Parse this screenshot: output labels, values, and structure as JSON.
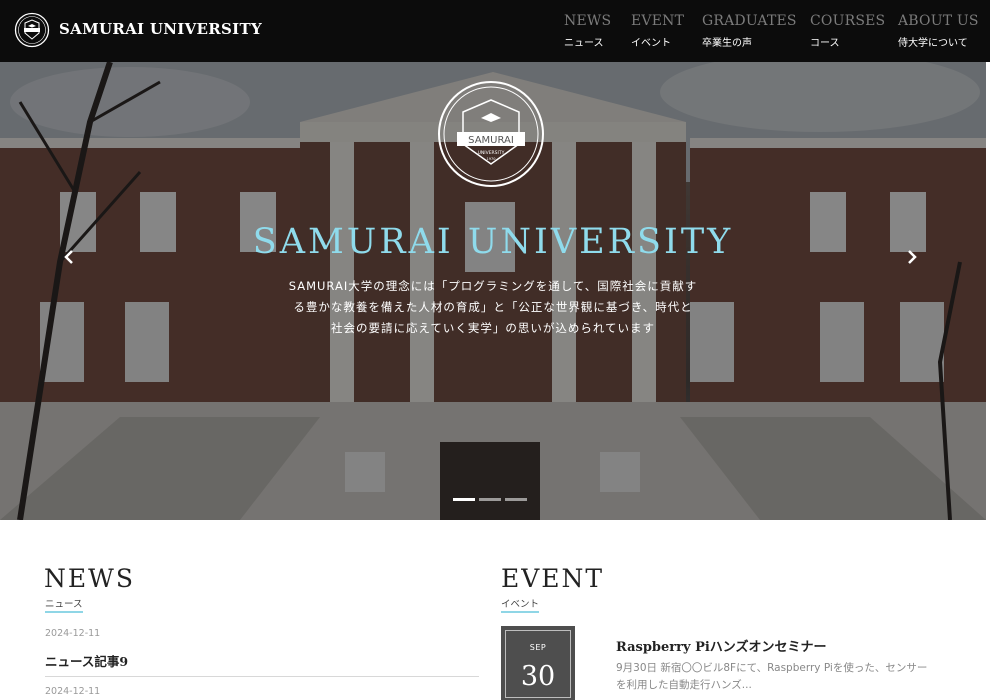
{
  "header": {
    "site_name": "SAMURAI UNIVERSITY",
    "nav": [
      {
        "en": "NEWS",
        "ja": "ニュース"
      },
      {
        "en": "EVENT",
        "ja": "イベント"
      },
      {
        "en": "GRADUATES",
        "ja": "卒業生の声"
      },
      {
        "en": "COURSES",
        "ja": "コース"
      },
      {
        "en": "ABOUT US",
        "ja": "侍大学について"
      }
    ]
  },
  "hero": {
    "emblem_text": "SAMURAI",
    "emblem_sub": "UNIVERSITY",
    "emblem_year": "1970",
    "title": "SAMURAI UNIVERSITY",
    "lines": [
      "SAMURAI大学の理念には「プログラミングを通して、国際社会に貢献す",
      "る豊かな教養を備えた人材の育成」と「公正な世界観に基づき、時代と",
      "社会の要請に応えていく実学」の思いが込められています"
    ],
    "prev_icon": "chevron-left-icon",
    "next_icon": "chevron-right-icon",
    "slides": 3,
    "active_slide": 1
  },
  "news": {
    "title": "NEWS",
    "subtitle": "ニュース",
    "items": [
      {
        "date": "2024-12-11",
        "title": "ニュース記事9"
      },
      {
        "date": "2024-12-11",
        "title": ""
      }
    ]
  },
  "event": {
    "title": "EVENT",
    "subtitle": "イベント",
    "items": [
      {
        "month": "SEP",
        "day": "30",
        "title": "Raspberry Piハンズオンセミナー",
        "desc": "9月30日 新宿〇〇ビル8Fにて、Raspberry Piを使った、センサーを利用した自動走行ハンズ..."
      }
    ]
  },
  "colors": {
    "accent": "#8fdbec",
    "header_bg": "#0c0c0c",
    "nav_en": "#7b7b7b",
    "date_box": "#4e4e4e"
  }
}
